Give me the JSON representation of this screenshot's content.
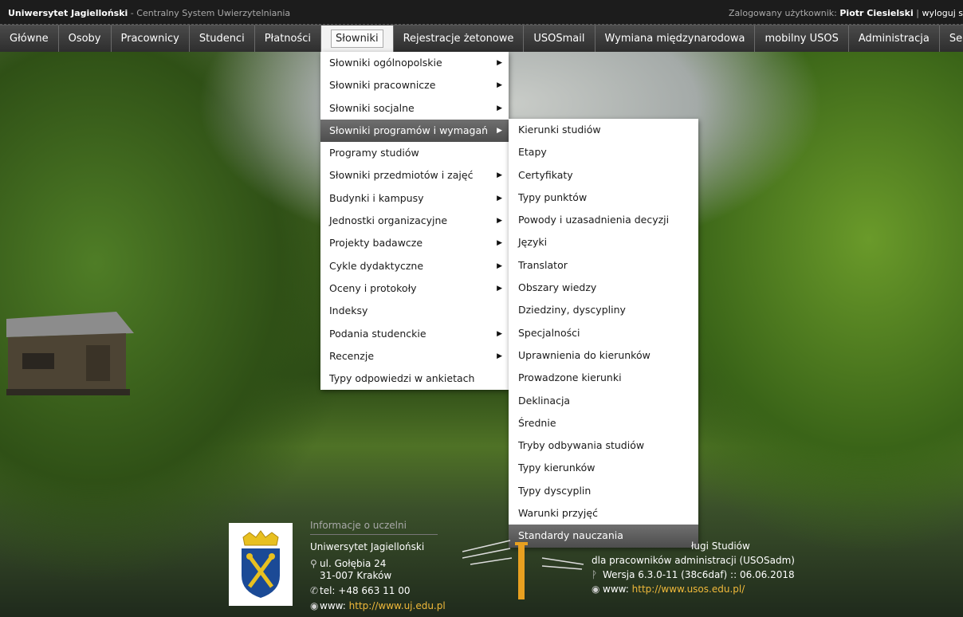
{
  "topbar": {
    "university": "Uniwersytet Jagielloński",
    "system": " - Centralny System Uwierzytelniania",
    "user_prefix": "Zalogowany użytkownik: ",
    "user_name": "Piotr Ciesielski",
    "separator": " | ",
    "logout": "wyloguj s"
  },
  "menu": [
    {
      "label": "Główne"
    },
    {
      "label": "Osoby"
    },
    {
      "label": "Pracownicy"
    },
    {
      "label": "Studenci"
    },
    {
      "label": "Płatności"
    },
    {
      "label": "Słowniki"
    },
    {
      "label": "Rejestracje żetonowe"
    },
    {
      "label": "USOSmail"
    },
    {
      "label": "Wymiana międzynarodowa"
    },
    {
      "label": "mobilny USOS"
    },
    {
      "label": "Administracja"
    },
    {
      "label": "Serwis"
    }
  ],
  "slowniki_menu": [
    {
      "label": "Słowniki ogólnopolskie",
      "arrow": "▶"
    },
    {
      "label": "Słowniki pracownicze",
      "arrow": "▶"
    },
    {
      "label": "Słowniki socjalne",
      "arrow": "▶"
    },
    {
      "label": "Słowniki programów i wymagań",
      "arrow": "▶"
    },
    {
      "label": "Programy studiów",
      "arrow": ""
    },
    {
      "label": "Słowniki przedmiotów i zajęć",
      "arrow": "▶"
    },
    {
      "label": "Budynki i kampusy",
      "arrow": "▶"
    },
    {
      "label": "Jednostki organizacyjne",
      "arrow": "▶"
    },
    {
      "label": "Projekty badawcze",
      "arrow": "▶"
    },
    {
      "label": "Cykle dydaktyczne",
      "arrow": "▶"
    },
    {
      "label": "Oceny i protokoły",
      "arrow": "▶"
    },
    {
      "label": "Indeksy",
      "arrow": ""
    },
    {
      "label": "Podania studenckie",
      "arrow": "▶"
    },
    {
      "label": "Recenzje",
      "arrow": "▶"
    },
    {
      "label": "Typy odpowiedzi w ankietach",
      "arrow": ""
    }
  ],
  "programy_submenu": [
    {
      "label": "Kierunki studiów"
    },
    {
      "label": "Etapy"
    },
    {
      "label": "Certyfikaty"
    },
    {
      "label": "Typy punktów"
    },
    {
      "label": "Powody i uzasadnienia decyzji"
    },
    {
      "label": "Języki"
    },
    {
      "label": "Translator"
    },
    {
      "label": "Obszary wiedzy"
    },
    {
      "label": "Dziedziny, dyscypliny"
    },
    {
      "label": "Specjalności"
    },
    {
      "label": "Uprawnienia do kierunków"
    },
    {
      "label": "Prowadzone kierunki"
    },
    {
      "label": "Deklinacja"
    },
    {
      "label": "Średnie"
    },
    {
      "label": "Tryby odbywania studiów"
    },
    {
      "label": "Typy kierunków"
    },
    {
      "label": "Typy dyscyplin"
    },
    {
      "label": "Warunki przyjęć"
    },
    {
      "label": "Standardy nauczania"
    }
  ],
  "footer": {
    "info_header": "Informacje o uczelni",
    "name": "Uniwersytet Jagielloński",
    "street": "ul. Gołębia 24",
    "city": "31-007 Kraków",
    "phone": "tel: +48 663 11 00",
    "www_label": "www: ",
    "www_link": "http://www.uj.edu.pl",
    "usos_line1": "ługi Studiów",
    "usos_line2": "dla pracowników administracji (USOSadm)",
    "version": "Wersja 6.3.0-11 (38c6daf) :: 06.06.2018",
    "usos_www_label": "www: ",
    "usos_www_link": "http://www.usos.edu.pl/"
  },
  "colors": {
    "link": "#f0b93a",
    "menubar": "#3a3a3a",
    "highlight": "#5a5a5a"
  }
}
